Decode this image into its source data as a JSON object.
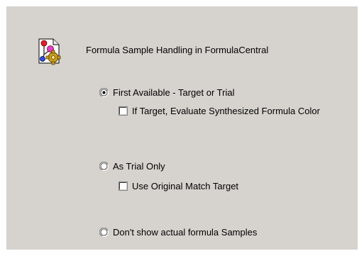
{
  "header": {
    "title": "Formula Sample Handling in FormulaCentral",
    "icon": "formula-molecule-gear-icon"
  },
  "options": [
    {
      "label": "First Available - Target or Trial",
      "selected": true,
      "sub_option": {
        "label": "If Target, Evaluate Synthesized Formula Color",
        "checked": false
      }
    },
    {
      "label": "As Trial Only",
      "selected": false,
      "sub_option": {
        "label": "Use Original Match Target",
        "checked": false
      }
    },
    {
      "label": "Don't show actual formula Samples",
      "selected": false
    }
  ],
  "colors": {
    "panel_bg": "#d6d3ce",
    "field_bg": "#ffffff"
  }
}
